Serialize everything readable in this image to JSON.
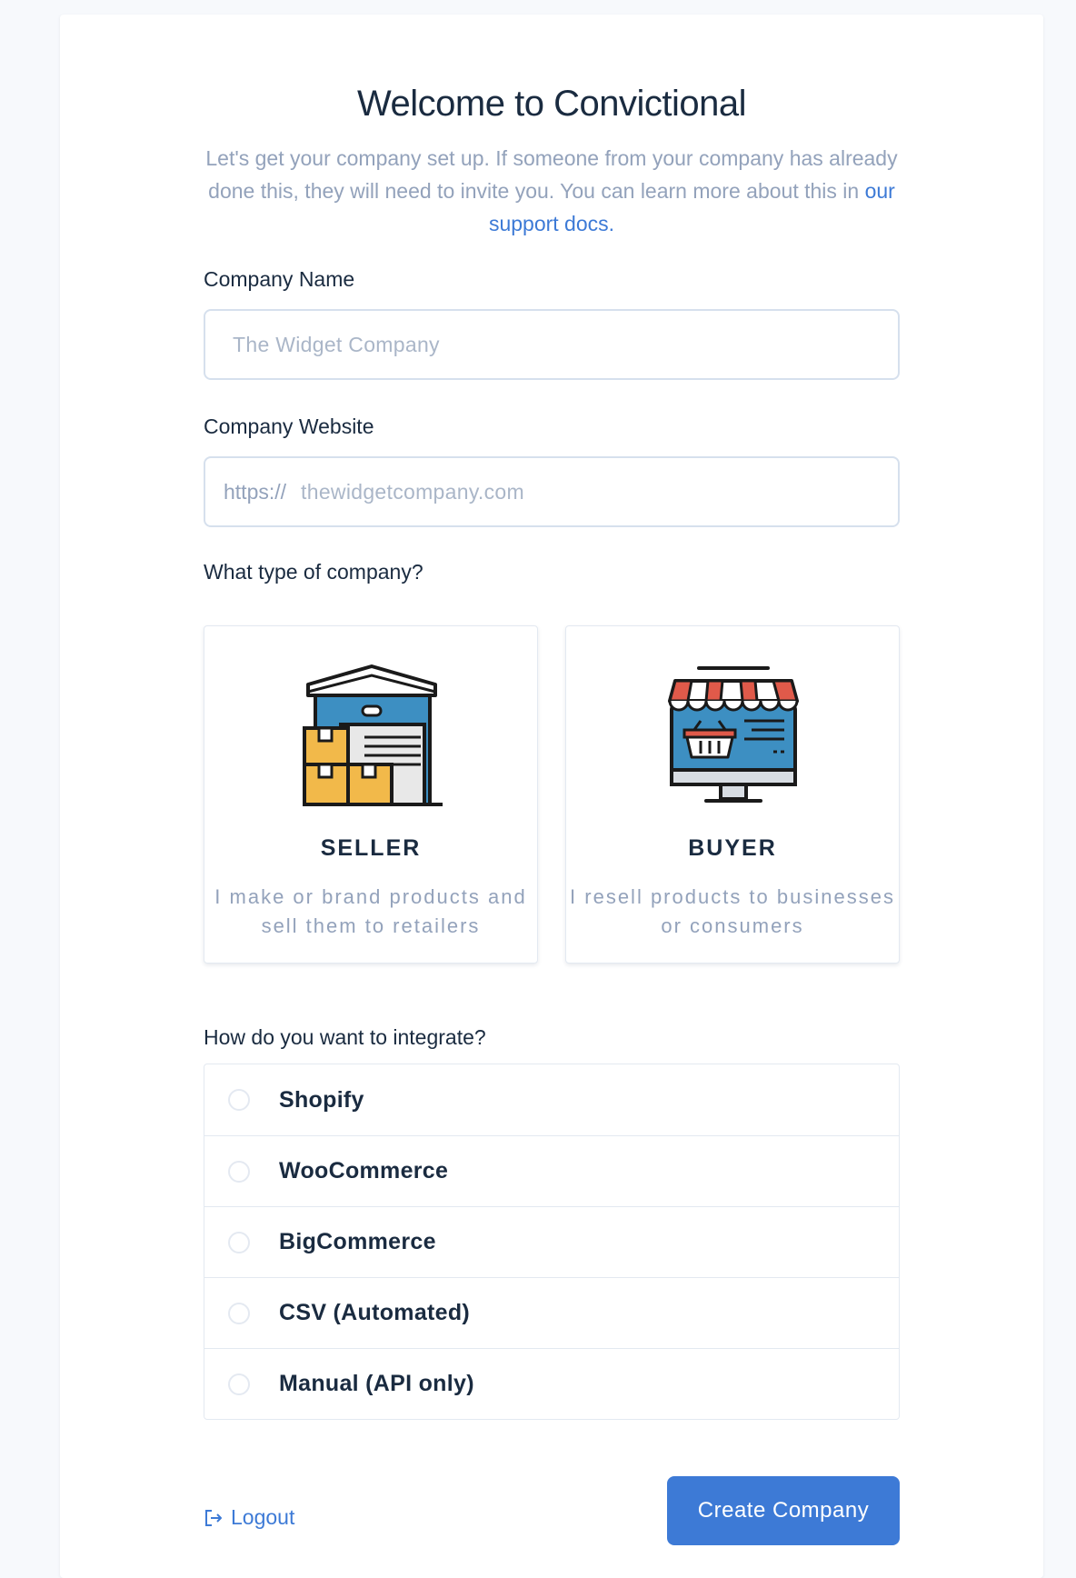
{
  "welcome": {
    "title": "Welcome to Convictional",
    "subtitle_text": "Let's get your company set up. If someone from your company has already done this, they will need to invite you. You can learn more about this in",
    "support_link": "our support docs."
  },
  "company_name": {
    "label": "Company Name",
    "placeholder": "The Widget Company"
  },
  "company_website": {
    "label": "Company Website",
    "prefix": "https://",
    "placeholder": "thewidgetcompany.com"
  },
  "company_type": {
    "label": "What type of company?",
    "seller": {
      "title": "SELLER",
      "description": "I make or brand products and sell them to retailers",
      "icon": "warehouse-icon"
    },
    "buyer": {
      "title": "BUYER",
      "description": "I resell products to businesses or consumers",
      "icon": "storefront-icon"
    }
  },
  "integration": {
    "label": "How do you want to integrate?",
    "options": [
      {
        "label": "Shopify"
      },
      {
        "label": "WooCommerce"
      },
      {
        "label": "BigCommerce"
      },
      {
        "label": "CSV (Automated)"
      },
      {
        "label": "Manual (API only)"
      }
    ]
  },
  "footer": {
    "logout_label": "Logout",
    "create_label": "Create Company"
  },
  "colors": {
    "accent": "#3d7ad6",
    "muted_text": "#93a2bb",
    "heading": "#1a2b40"
  }
}
